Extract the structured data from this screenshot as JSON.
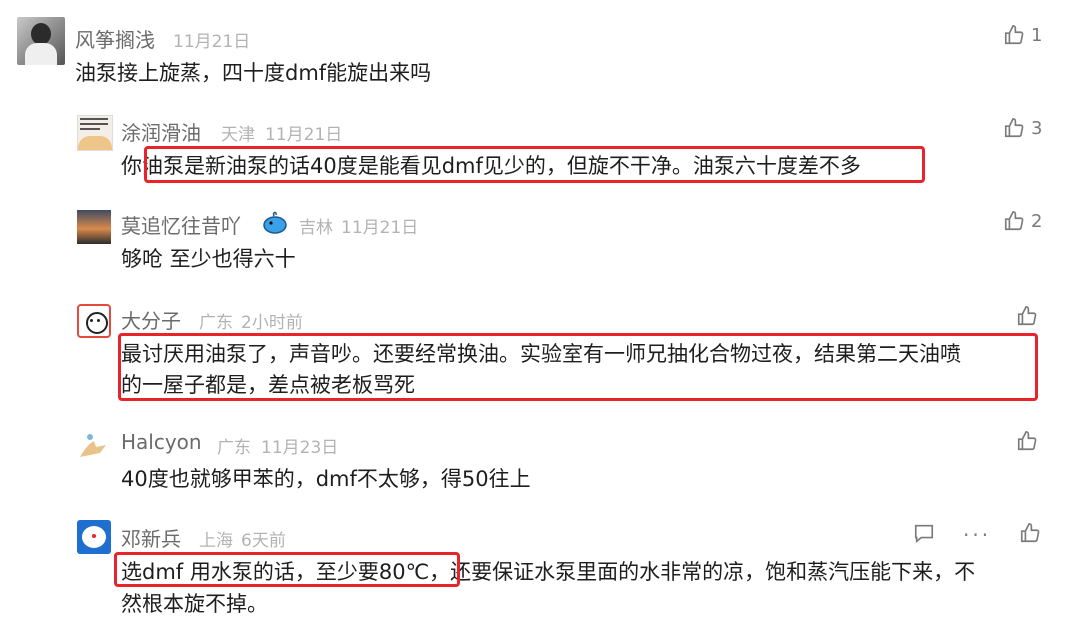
{
  "comments": [
    {
      "user": "风筝搁浅",
      "location": "",
      "time": "11月21日",
      "likes": "1",
      "text": "油泵接上旋蒸，四十度dmf能旋出来吗"
    },
    {
      "user": "涂润滑油",
      "location": "天津",
      "time": "11月21日",
      "likes": "3",
      "text": "你油泵是新油泵的话40度是能看见dmf见少的，但旋不干净。油泵六十度差不多"
    },
    {
      "user": "莫追忆往昔吖",
      "location": "吉林",
      "time": "11月21日",
      "likes": "2",
      "text": "够呛 至少也得六十"
    },
    {
      "user": "大分子",
      "location": "广东",
      "time": "2小时前",
      "likes": "",
      "text_line1": "最讨厌用油泵了，声音吵。还要经常换油。实验室有一师兄抽化合物过夜，结果第二天油喷",
      "text_line2": "的一屋子都是，差点被老板骂死"
    },
    {
      "user": "Halcyon",
      "location": "广东",
      "time": "11月23日",
      "likes": "",
      "text": "40度也就够甲苯的，dmf不太够，得50往上"
    },
    {
      "user": "邓新兵",
      "location": "上海",
      "time": "6天前",
      "likes": "",
      "text_line1": "选dmf 用水泵的话，至少要80℃，还要保证水泵里面的水非常的凉，饱和蒸汽压能下来，不",
      "text_line2": "然根本旋不掉。",
      "more_glyph": "···"
    }
  ],
  "colors": {
    "highlight": "#e8232a",
    "meta": "#b3b3b3",
    "name": "#6b6b6b"
  },
  "icons": [
    "thumb-up-icon",
    "comment-icon",
    "more-icon"
  ]
}
